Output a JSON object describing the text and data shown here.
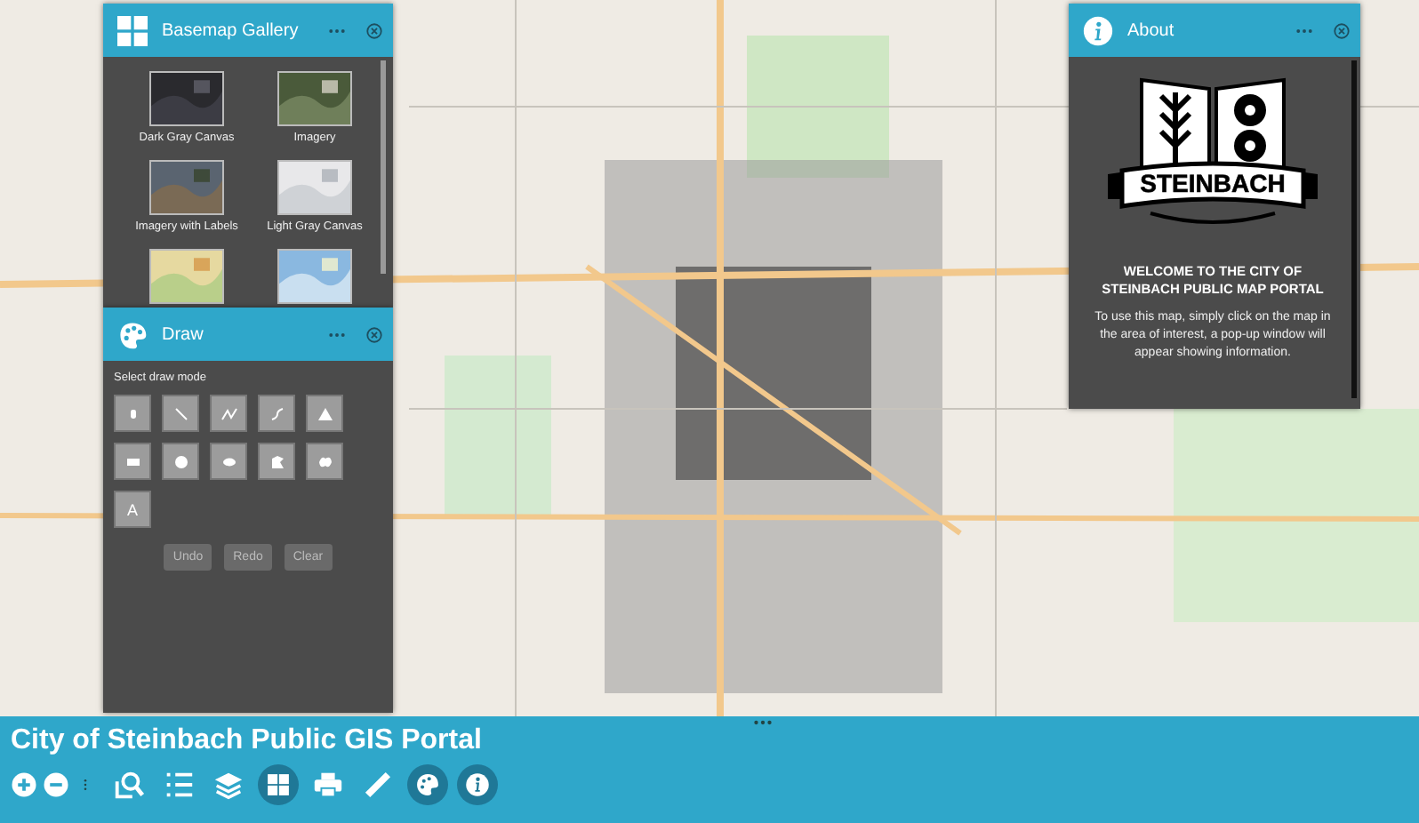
{
  "basemap_gallery": {
    "title": "Basemap Gallery",
    "items": [
      {
        "kind": "picture",
        "label": "Dark Gray Canvas"
      },
      {
        "kind": "picture",
        "label": "Imagery"
      },
      {
        "kind": "picture",
        "label": "Imagery with Labels"
      },
      {
        "kind": "picture",
        "label": "Light Gray Canvas"
      },
      {
        "kind": "picture"
      },
      {
        "kind": "picture"
      }
    ]
  },
  "draw": {
    "title": "Draw",
    "prompt": "Select draw mode",
    "modes": [
      {
        "kind": "point"
      },
      {
        "kind": "line"
      },
      {
        "kind": "polyline"
      },
      {
        "kind": "freehand-line"
      },
      {
        "kind": "triangle"
      },
      {
        "kind": "rectangle"
      },
      {
        "kind": "circle"
      },
      {
        "kind": "ellipse"
      },
      {
        "kind": "polygon"
      },
      {
        "kind": "freehand-polygon"
      },
      {
        "kind": "text",
        "label": "A"
      }
    ],
    "actions": [
      {
        "label": "Undo",
        "disabled": true
      },
      {
        "label": "Redo",
        "disabled": true
      },
      {
        "label": "Clear",
        "disabled": true
      }
    ]
  },
  "about": {
    "title": "About",
    "logo_text": "STEINBACH",
    "heading": "WELCOME TO THE CITY OF STEINBACH PUBLIC MAP PORTAL",
    "body": "To use this map, simply click on the map in the area of interest, a pop-up window will appear showing information."
  },
  "app_title": "City of Steinbach Public GIS Portal",
  "toolbar": [
    {
      "kind": "zoom-in",
      "selected": false
    },
    {
      "kind": "zoom-out",
      "selected": false
    },
    {
      "kind": "more",
      "selected": false
    },
    {
      "kind": "query",
      "selected": false
    },
    {
      "kind": "legend",
      "selected": false
    },
    {
      "kind": "layers",
      "selected": false
    },
    {
      "kind": "basemap",
      "selected": true
    },
    {
      "kind": "print",
      "selected": false
    },
    {
      "kind": "measure",
      "selected": false
    },
    {
      "kind": "draw",
      "selected": true
    },
    {
      "kind": "about",
      "selected": true
    }
  ]
}
